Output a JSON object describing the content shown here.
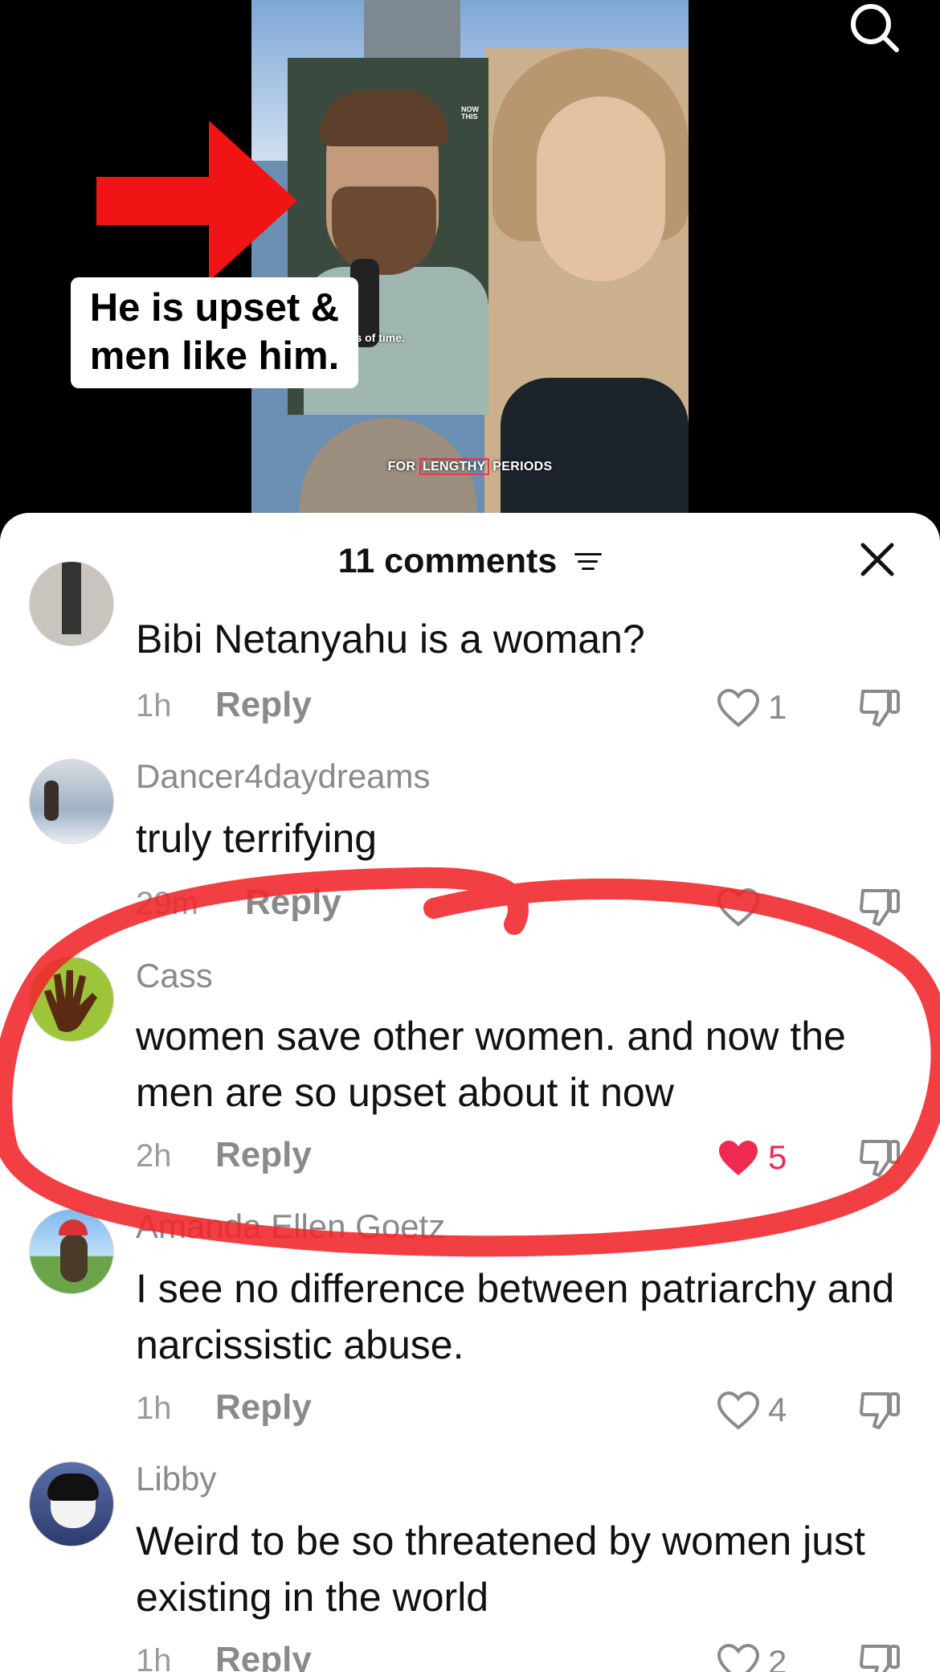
{
  "video": {
    "caption_overlay": "He is upset & men like him.",
    "caption_line1": "He is upset &",
    "caption_line2": "men like him.",
    "inset_brand": "NOW THIS",
    "inset_caption": "riods of time.",
    "subtitle_before": "FOR",
    "subtitle_highlight": "LENGTHY",
    "subtitle_after": "PERIODS",
    "search_icon": "search-icon"
  },
  "sheet": {
    "comment_count": "11 comments",
    "filter_icon": "filter-icon",
    "close_icon": "close-icon"
  },
  "comments": [
    {
      "username": "",
      "text": "Bibi Netanyahu is a woman?",
      "time": "1h",
      "reply_label": "Reply",
      "likes": "1",
      "liked": false
    },
    {
      "username": "Dancer4daydreams",
      "text": "truly terrifying",
      "time": "29m",
      "reply_label": "Reply",
      "likes": "",
      "liked": false
    },
    {
      "username": "Cass",
      "text": "women save other women. and now the men are so upset about it now",
      "time": "2h",
      "reply_label": "Reply",
      "likes": "5",
      "liked": true
    },
    {
      "username": "Amanda Ellen Goetz",
      "text": "I see no difference between patriarchy and narcissistic abuse.",
      "time": "1h",
      "reply_label": "Reply",
      "likes": "4",
      "liked": false
    },
    {
      "username": "Libby",
      "text": "Weird to be so threatened by women just existing in the world",
      "time": "1h",
      "reply_label": "Reply",
      "likes": "2",
      "liked": false
    }
  ],
  "colors": {
    "like_red": "#ef2950",
    "annotation_red": "#f0242a"
  }
}
